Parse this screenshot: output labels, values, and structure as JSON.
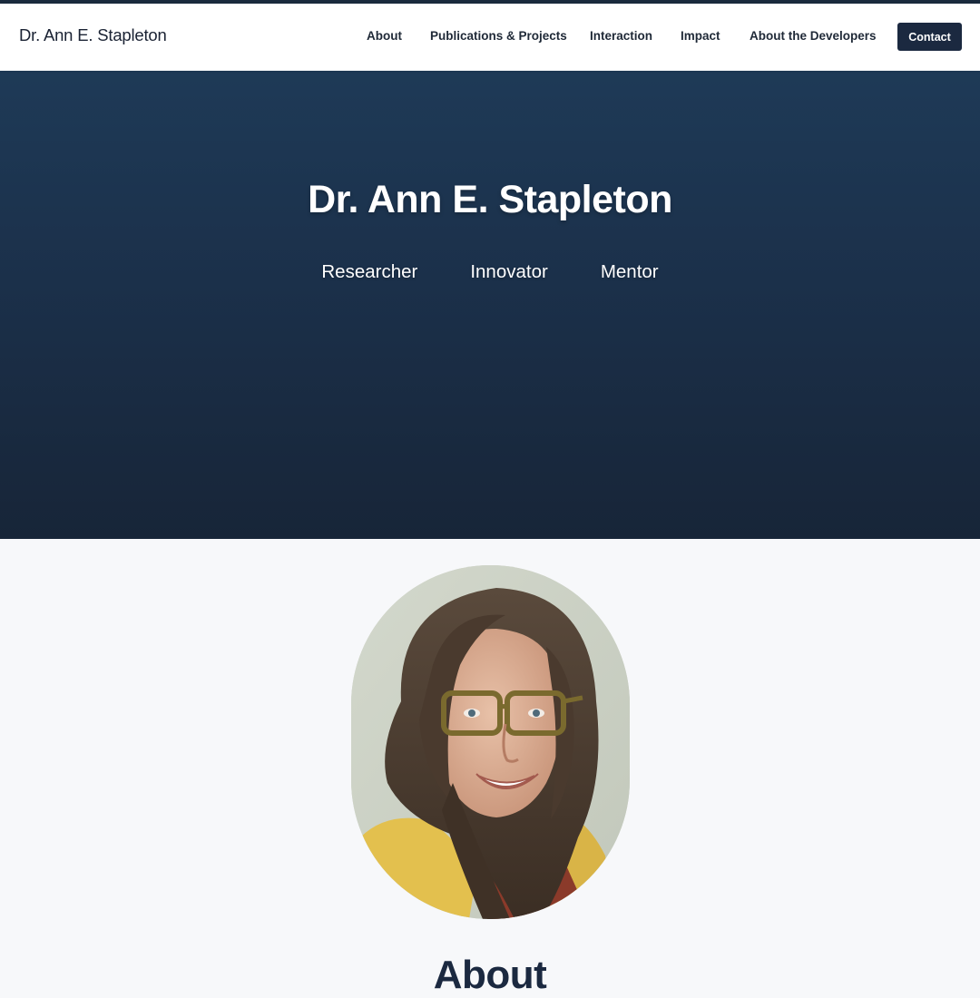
{
  "brand": "Dr. Ann E. Stapleton",
  "nav": {
    "about": "About",
    "publications": "Publications & Projects",
    "interaction": "Interaction",
    "impact": "Impact",
    "developers": "About the Developers",
    "contact": "Contact"
  },
  "hero": {
    "title": "Dr. Ann E. Stapleton",
    "roles": [
      "Researcher",
      "Innovator",
      "Mentor"
    ]
  },
  "about": {
    "heading": "About"
  },
  "colors": {
    "navy": "#1b2940",
    "hero_top": "#1e3a57",
    "hero_bottom": "#172538",
    "page_bg": "#f7f8fa"
  }
}
